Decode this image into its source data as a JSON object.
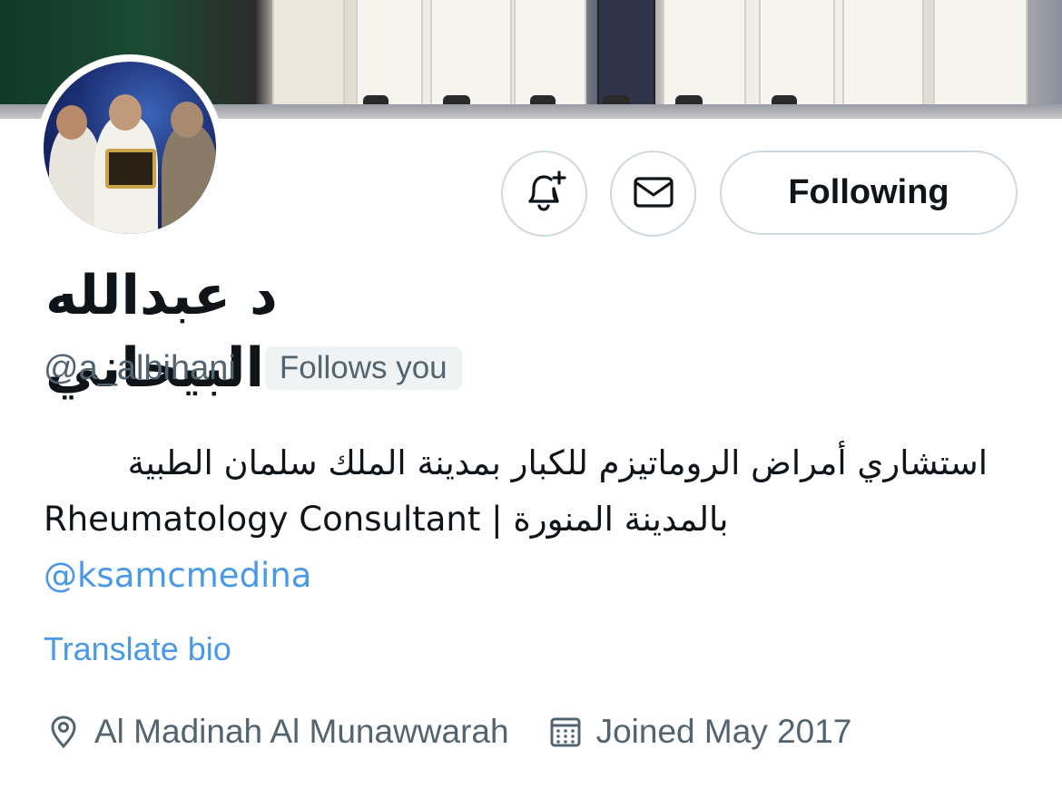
{
  "profile": {
    "display_name": "د عبدالله البيحاني",
    "handle": "@a_albihani",
    "follows_you_badge": "Follows you"
  },
  "actions": {
    "notify_icon": "bell-plus-icon",
    "message_icon": "envelope-icon",
    "follow_label": "Following"
  },
  "bio": {
    "line1": "استشاري أمراض الروماتيزم للكبار بمدينة الملك سلمان الطبية",
    "line2_en": "Rheumatology Consultant",
    "line2_sep": " | ",
    "line2_ar": "بالمدينة المنورة",
    "mention": "@ksamcmedina",
    "translate_label": "Translate bio"
  },
  "meta": {
    "location_icon": "location-pin-icon",
    "location": "Al Madinah Al Munawwarah",
    "joined_icon": "calendar-icon",
    "joined": "Joined May 2017"
  },
  "colors": {
    "link": "#4a99e9",
    "secondary_text": "#536471",
    "primary_text": "#0f1419",
    "border": "#cfd9de",
    "badge_bg": "#eff3f4"
  }
}
